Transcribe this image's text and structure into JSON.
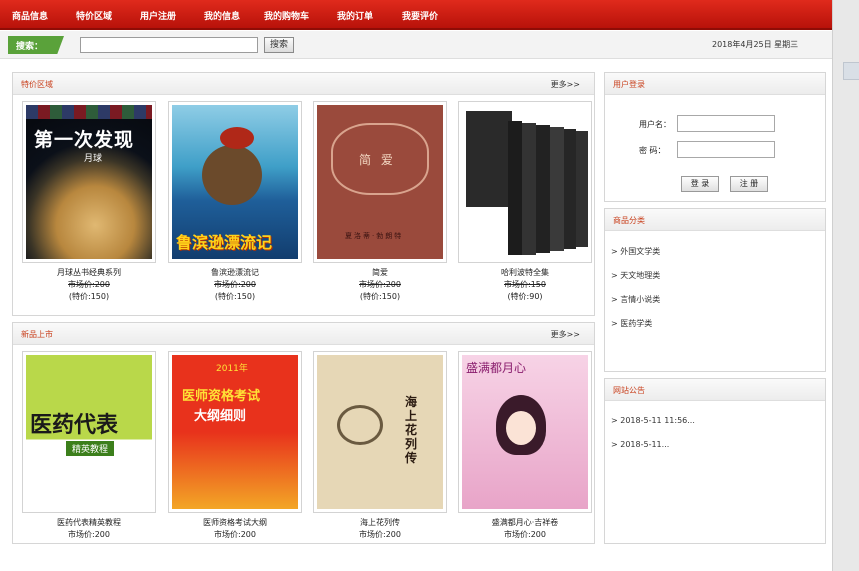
{
  "nav": {
    "items": [
      "商品信息",
      "特价区域",
      "用户注册",
      "我的信息",
      "我的购物车",
      "我的订单",
      "我要评价"
    ]
  },
  "search": {
    "label": "搜索：",
    "value": "",
    "placeholder": "",
    "button_label": "搜索"
  },
  "date_text": "2018年4月25日  星期三",
  "special_section": {
    "title": "特价区域",
    "more": "更多>>",
    "books": [
      {
        "name": "月球丛书经典系列",
        "old_price": "市场价:200",
        "new_price": "(特价:150)",
        "cover_title": "第一次发现",
        "cover_sub": "月球"
      },
      {
        "name": "鲁滨逊漂流记",
        "old_price": "市场价:200",
        "new_price": "(特价:150)",
        "cover_title": "鲁滨逊漂流记"
      },
      {
        "name": "简爱",
        "old_price": "市场价:200",
        "new_price": "(特价:150)",
        "cover_title": "简  爱",
        "cover_sub": "夏洛蒂·勃朗特"
      },
      {
        "name": "哈利波特全集",
        "old_price": "市场价:150",
        "new_price": "(特价:90)"
      }
    ]
  },
  "new_section": {
    "title": "新品上市",
    "more": "更多>>",
    "books": [
      {
        "name": "医药代表精英教程",
        "price": "市场价:200",
        "cover_title": "医药代表",
        "cover_sub": "精英教程"
      },
      {
        "name": "医师资格考试大纲",
        "price": "市场价:200",
        "cover_year": "2011年",
        "cover_title": "医师资格考试",
        "cover_sub": "大纲细则"
      },
      {
        "name": "海上花列传",
        "price": "市场价:200",
        "cover_title": "海上花列传"
      },
      {
        "name": "盛满都月心·吉祥卷",
        "price": "市场价:200",
        "cover_title": "盛满都月心"
      }
    ]
  },
  "login_panel": {
    "title": "用户登录",
    "username_label": "用户名：",
    "password_label": "密  码：",
    "login_button": "登 录",
    "register_button": "注 册"
  },
  "category_panel": {
    "title": "商品分类",
    "items": [
      "> 外国文学类",
      "> 天文地理类",
      "> 言情小说类",
      "> 医药学类"
    ]
  },
  "notice_panel": {
    "title": "网站公告",
    "items": [
      "> 2018-5-11 11:56...",
      "> 2018-5-11..."
    ]
  },
  "colors": {
    "nav_red": "#d01e12",
    "search_green": "#5aa23a",
    "panel_title": "#c9421f"
  }
}
